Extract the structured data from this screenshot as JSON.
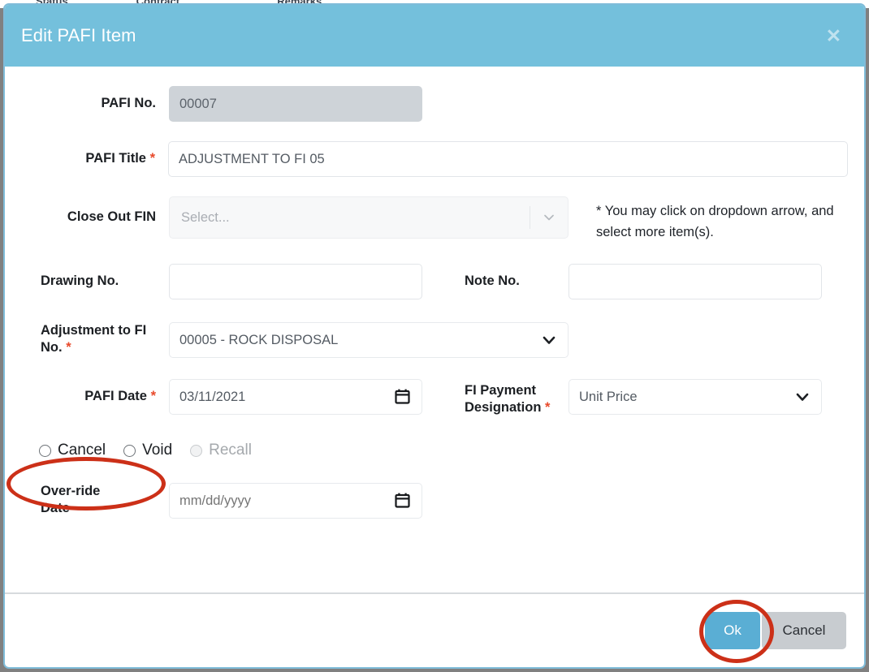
{
  "background": {
    "columns": [
      "Status",
      "Contract",
      "Remarks"
    ]
  },
  "modal": {
    "title": "Edit PAFI Item",
    "close_icon": "close-icon",
    "fields": {
      "pafi_no": {
        "label": "PAFI No.",
        "value": "00007",
        "disabled": true
      },
      "pafi_title": {
        "label": "PAFI Title",
        "required_marker": "*",
        "value": "ADJUSTMENT TO FI 05"
      },
      "close_out_fin": {
        "label": "Close Out FIN",
        "placeholder": "Select...",
        "value": "",
        "hint": "* You may click on dropdown arrow, and select more item(s)."
      },
      "drawing_no": {
        "label": "Drawing No.",
        "value": "",
        "placeholder": ""
      },
      "note_no": {
        "label": "Note No.",
        "value": "",
        "placeholder": ""
      },
      "adjustment_to_fi_no": {
        "label": "Adjustment to FI No.",
        "required_marker": "*",
        "selected": "00005 - ROCK DISPOSAL",
        "options": [
          "00005 - ROCK DISPOSAL"
        ]
      },
      "pafi_date": {
        "label": "PAFI Date",
        "required_marker": "*",
        "value": "03/11/2021",
        "placeholder": "mm/dd/yyyy"
      },
      "fi_payment_designation": {
        "label_line1": "FI Payment",
        "label_line2": "Designation",
        "required_marker": "*",
        "selected": "Unit Price",
        "options": [
          "Unit Price"
        ]
      },
      "status_radios": [
        {
          "label": "Cancel",
          "selected": false,
          "disabled": false
        },
        {
          "label": "Void",
          "selected": false,
          "disabled": false
        },
        {
          "label": "Recall",
          "selected": false,
          "disabled": true
        }
      ],
      "override_date": {
        "label_line1": "Over-ride",
        "label_line2": "Date",
        "value": "",
        "placeholder": "mm/dd/yyyy"
      }
    },
    "footer": {
      "ok_label": "Ok",
      "cancel_label": "Cancel"
    }
  },
  "annotations": {
    "color": "#cc3018",
    "items": [
      {
        "name": "radio-group-highlight",
        "shape": "ellipse"
      },
      {
        "name": "ok-button-highlight",
        "shape": "ellipse"
      }
    ]
  }
}
